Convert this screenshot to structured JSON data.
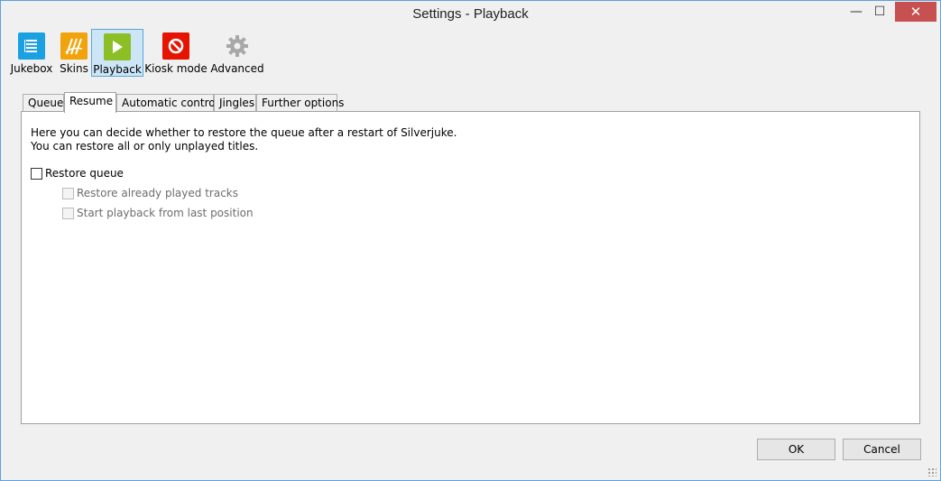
{
  "window": {
    "title": "Settings - Playback",
    "minimize_glyph": "—",
    "maximize_glyph": "☐",
    "close_glyph": "✕"
  },
  "toolbar": {
    "items": [
      {
        "label": "Jukebox",
        "icon": "jukebox-icon",
        "color": "#1ba1e2",
        "selected": false
      },
      {
        "label": "Skins",
        "icon": "skins-icon",
        "color": "#f0a30a",
        "selected": false
      },
      {
        "label": "Playback",
        "icon": "playback-icon",
        "color": "#8cbf26",
        "selected": true
      },
      {
        "label": "Kiosk mode",
        "icon": "kiosk-icon",
        "color": "#e51400",
        "selected": false
      },
      {
        "label": "Advanced",
        "icon": "gear-icon",
        "color": "#9e9e9e",
        "selected": false
      }
    ]
  },
  "tabs": {
    "items": [
      {
        "label": "Queue",
        "active": false
      },
      {
        "label": "Resume",
        "active": true
      },
      {
        "label": "Automatic control",
        "active": false
      },
      {
        "label": "Jingles",
        "active": false
      },
      {
        "label": "Further options",
        "active": false
      }
    ]
  },
  "panel": {
    "description_line1": "Here you can decide whether to restore the queue after a restart of Silverjuke.",
    "description_line2": "You can restore all or only unplayed titles.",
    "restore_queue": {
      "label": "Restore queue",
      "checked": false,
      "enabled": true
    },
    "restore_played": {
      "label": "Restore already played tracks",
      "checked": false,
      "enabled": false
    },
    "start_last_position": {
      "label": "Start playback from last position",
      "checked": false,
      "enabled": false
    }
  },
  "buttons": {
    "ok": "OK",
    "cancel": "Cancel"
  },
  "colors": {
    "selection_bg": "#cde6f7",
    "selection_border": "#5ba4d8",
    "close_button": "#c75050"
  }
}
